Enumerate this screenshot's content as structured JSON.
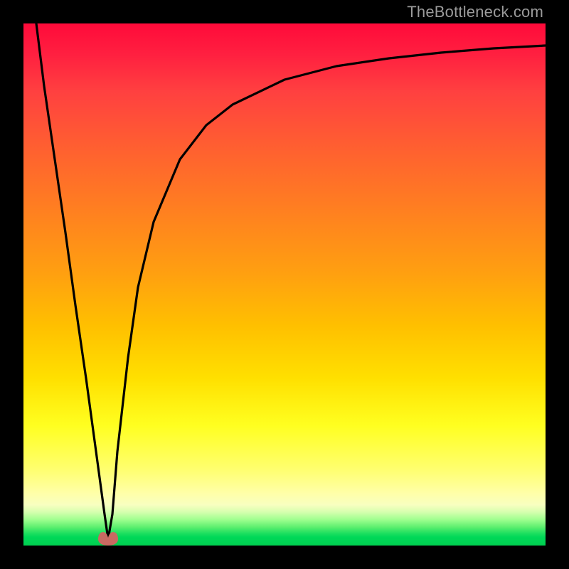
{
  "watermark": "TheBottleneck.com",
  "colors": {
    "frame": "#000000",
    "gradient_top": "#ff0a3a",
    "gradient_bottom": "#00d050",
    "curve": "#000000",
    "blob": "#c96a62",
    "watermark": "#9a9a9a"
  },
  "chart_data": {
    "type": "line",
    "title": "",
    "xlabel": "",
    "ylabel": "",
    "xlim": [
      0,
      100
    ],
    "ylim": [
      0,
      100
    ],
    "series": [
      {
        "name": "curve",
        "x": [
          2.5,
          4,
          6,
          8,
          10,
          12,
          14,
          15.5,
          16.2,
          17,
          18,
          20,
          22,
          25,
          30,
          35,
          40,
          50,
          60,
          70,
          80,
          90,
          100
        ],
        "y": [
          100,
          88,
          74,
          60,
          46,
          32,
          17,
          6,
          1.2,
          6,
          18,
          36,
          49.5,
          62,
          74,
          80.5,
          84.5,
          89.3,
          91.8,
          93.3,
          94.4,
          95.2,
          95.8
        ],
        "note": "y is percentage height from bottom; minimum ~1% occurs near x≈16.2 then curve rises asymptotically toward ~96"
      }
    ],
    "annotations": [
      {
        "name": "minimum-marker",
        "x": 16.2,
        "y": 0.8,
        "shape": "two-lobed-blob",
        "color": "#c96a62"
      }
    ]
  }
}
